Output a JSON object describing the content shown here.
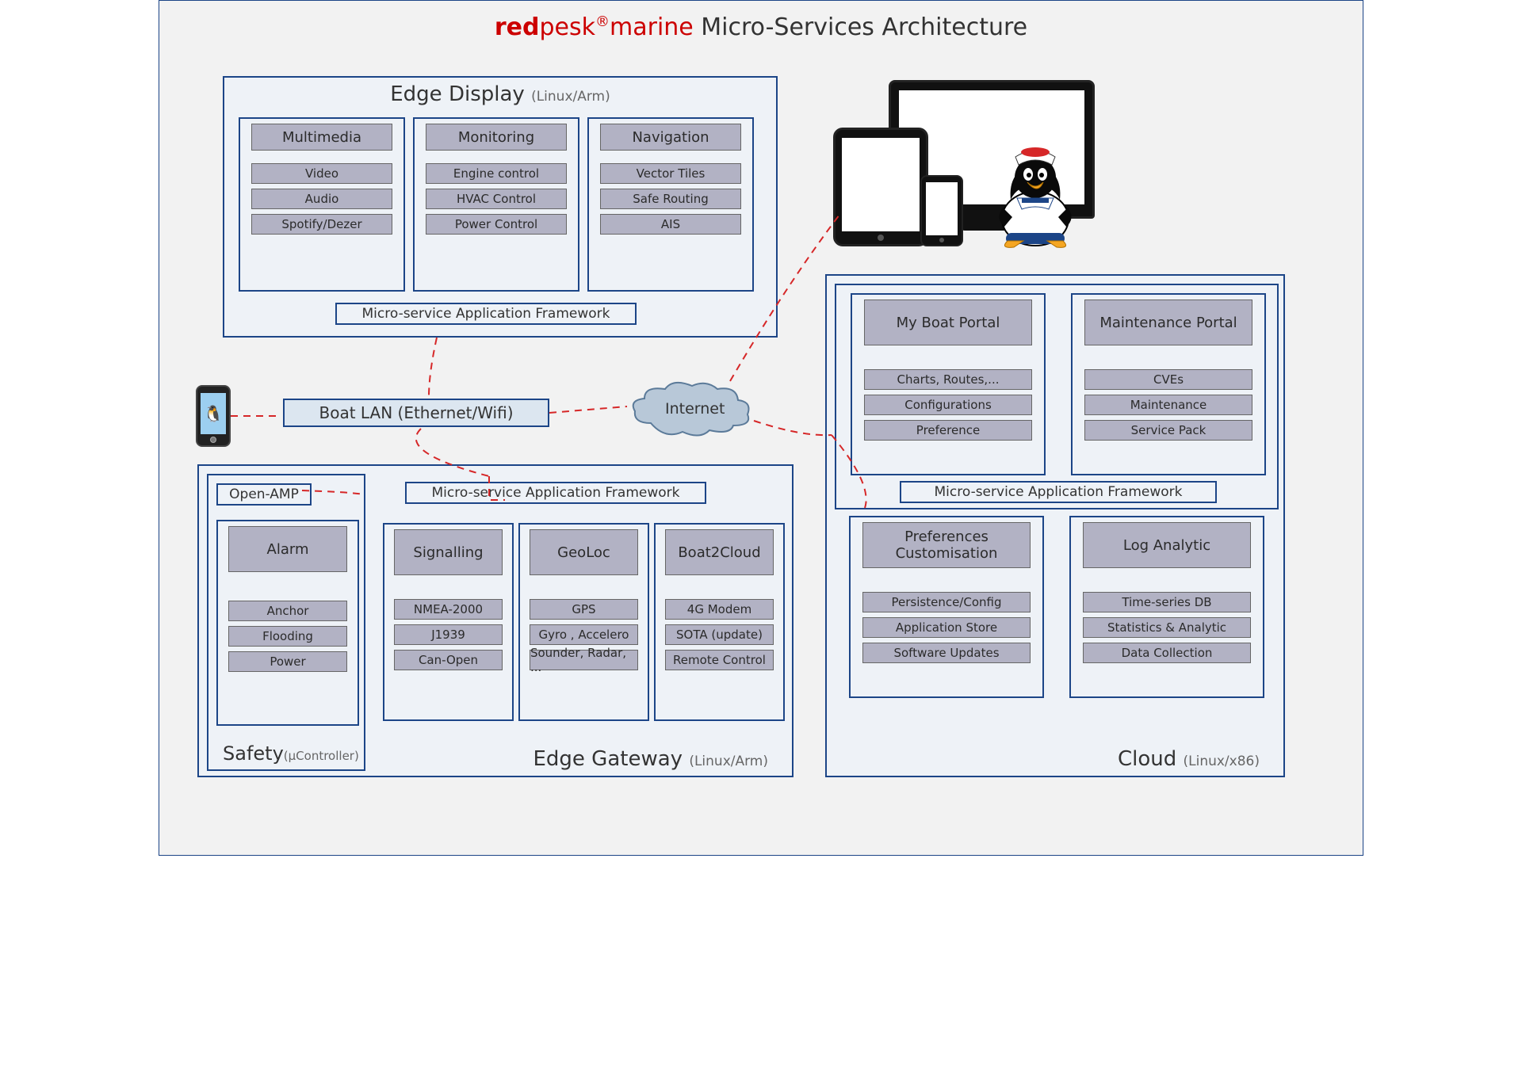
{
  "title": {
    "brand1": "red",
    "brand2": "pesk",
    "reg": "®",
    "brand3": "marine",
    "rest": " Micro-Services Architecture"
  },
  "edge_display": {
    "title": "Edge Display",
    "sub": "(Linux/Arm)",
    "cols": [
      {
        "hdr": "Multimedia",
        "items": [
          "Video",
          "Audio",
          "Spotify/Dezer"
        ]
      },
      {
        "hdr": "Monitoring",
        "items": [
          "Engine control",
          "HVAC Control",
          "Power Control"
        ]
      },
      {
        "hdr": "Navigation",
        "items": [
          "Vector Tiles",
          "Safe Routing",
          "AIS"
        ]
      }
    ],
    "framework": "Micro-service Application Framework"
  },
  "boat_lan": "Boat LAN (Ethernet/Wifi)",
  "internet": "Internet",
  "edge_gateway": {
    "title": "Edge Gateway",
    "sub": "(Linux/Arm)",
    "safety_title": "Safety",
    "safety_sub": "(µController)",
    "open_amp": "Open-AMP",
    "framework": "Micro-service Application Framework",
    "alarm": {
      "hdr": "Alarm",
      "items": [
        "Anchor",
        "Flooding",
        "Power"
      ]
    },
    "cols": [
      {
        "hdr": "Signalling",
        "items": [
          "NMEA-2000",
          "J1939",
          "Can-Open"
        ]
      },
      {
        "hdr": "GeoLoc",
        "items": [
          "GPS",
          "Gyro , Accelero",
          "Sounder, Radar, ..."
        ]
      },
      {
        "hdr": "Boat2Cloud",
        "items": [
          "4G Modem",
          "SOTA (update)",
          "Remote Control"
        ]
      }
    ]
  },
  "cloud": {
    "title": "Cloud",
    "sub": "(Linux/x86)",
    "framework": "Micro-service Application Framework",
    "top": [
      {
        "hdr": "My Boat Portal",
        "items": [
          "Charts, Routes,...",
          "Configurations",
          "Preference"
        ]
      },
      {
        "hdr": "Maintenance Portal",
        "items": [
          "CVEs",
          "Maintenance",
          "Service Pack"
        ]
      }
    ],
    "bottom": [
      {
        "hdr": "Preferences Customisation",
        "items": [
          "Persistence/Config",
          "Application Store",
          "Software Updates"
        ]
      },
      {
        "hdr": "Log Analytic",
        "items": [
          "Time-series DB",
          "Statistics & Analytic",
          "Data Collection"
        ]
      }
    ]
  }
}
